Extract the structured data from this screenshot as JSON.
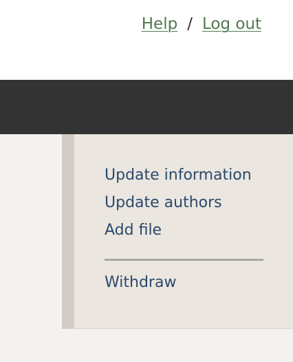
{
  "header": {
    "links": {
      "help": "Help",
      "separator": "/",
      "logout": "Log out"
    }
  },
  "actions": {
    "items": [
      {
        "label": "Update information"
      },
      {
        "label": "Update authors"
      },
      {
        "label": "Add file"
      }
    ],
    "withdraw_label": "Withdraw"
  },
  "colors": {
    "link_green": "#4f7a4e",
    "nav_dark": "#333333",
    "panel_bg": "#ebe6e0",
    "panel_border": "#d3ccc5",
    "action_link": "#2b4a6b"
  }
}
